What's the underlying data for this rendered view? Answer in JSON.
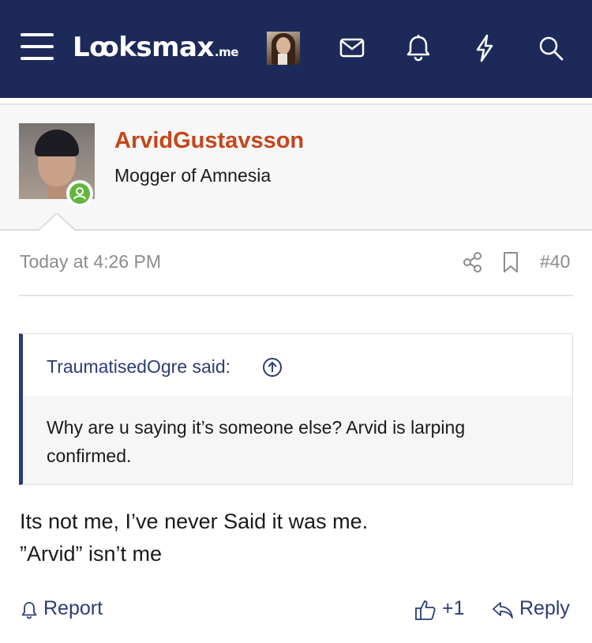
{
  "header": {
    "logo_main": "Lꝏksmax",
    "logo_suffix": ".me",
    "icons": [
      "menu-icon",
      "user-avatar",
      "mail-icon",
      "bell-icon",
      "lightning-icon",
      "search-icon"
    ],
    "background": "#1d2a59"
  },
  "post": {
    "author": "ArvidGustavsson",
    "author_color": "#c4461b",
    "user_title": "Mogger of Amnesia",
    "status": "online",
    "timestamp": "Today at 4:26 PM",
    "post_number": "#40",
    "meta_icons": [
      "share-icon",
      "bookmark-icon"
    ],
    "quote": {
      "author_line": "TraumatisedOgre said:",
      "text": "Why are u saying it’s someone else? Arvid is larping confirmed."
    },
    "message_lines": [
      "Its not me, I’ve never Said it was me.",
      "”Arvid” isn’t me"
    ],
    "actions": {
      "report_label": "Report",
      "reaction_count": "+1",
      "reply_label": "Reply"
    }
  }
}
